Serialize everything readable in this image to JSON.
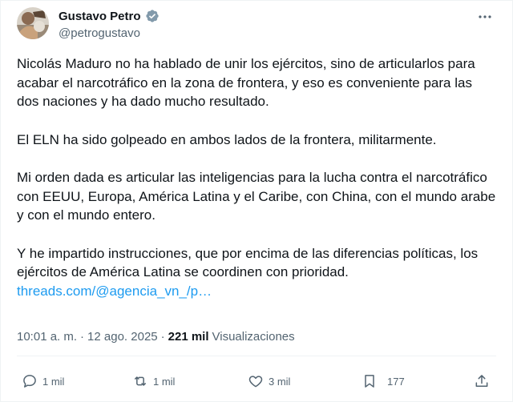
{
  "author": {
    "name": "Gustavo Petro",
    "handle": "@petrogustavo"
  },
  "tweet": {
    "paragraphs": [
      "Nicolás Maduro no ha hablado de unir los ejércitos,  sino de articularlos para acabar el narcotráfico en la zona de frontera, y eso es conveniente para las dos naciones y ha dado mucho resultado.",
      "El ELN ha sido golpeado en ambos lados de  la frontera, militarmente.",
      "Mi orden dada es articular las inteligencias para la lucha contra el narcotráfico con EEUU, Europa, América Latina y el Caribe, con China, con el mundo arabe  y con el mundo entero.",
      "Y he impartido instrucciones, que por encima de las diferencias políticas, los ejércitos de América Latina se coordinen con prioridad."
    ],
    "link_text": "threads.com/@agencia_vn_/p…"
  },
  "meta": {
    "time": "10:01 a. m.",
    "separator": "·",
    "date": "12 ago. 2025",
    "views_count": "221 mil",
    "views_label": "Visualizaciones"
  },
  "actions": {
    "replies": "1 mil",
    "reposts": "1 mil",
    "likes": "3 mil",
    "bookmarks": "177"
  },
  "colors": {
    "link": "#1d9bf0",
    "secondary_text": "#536471",
    "verified_badge": "#829aab"
  }
}
